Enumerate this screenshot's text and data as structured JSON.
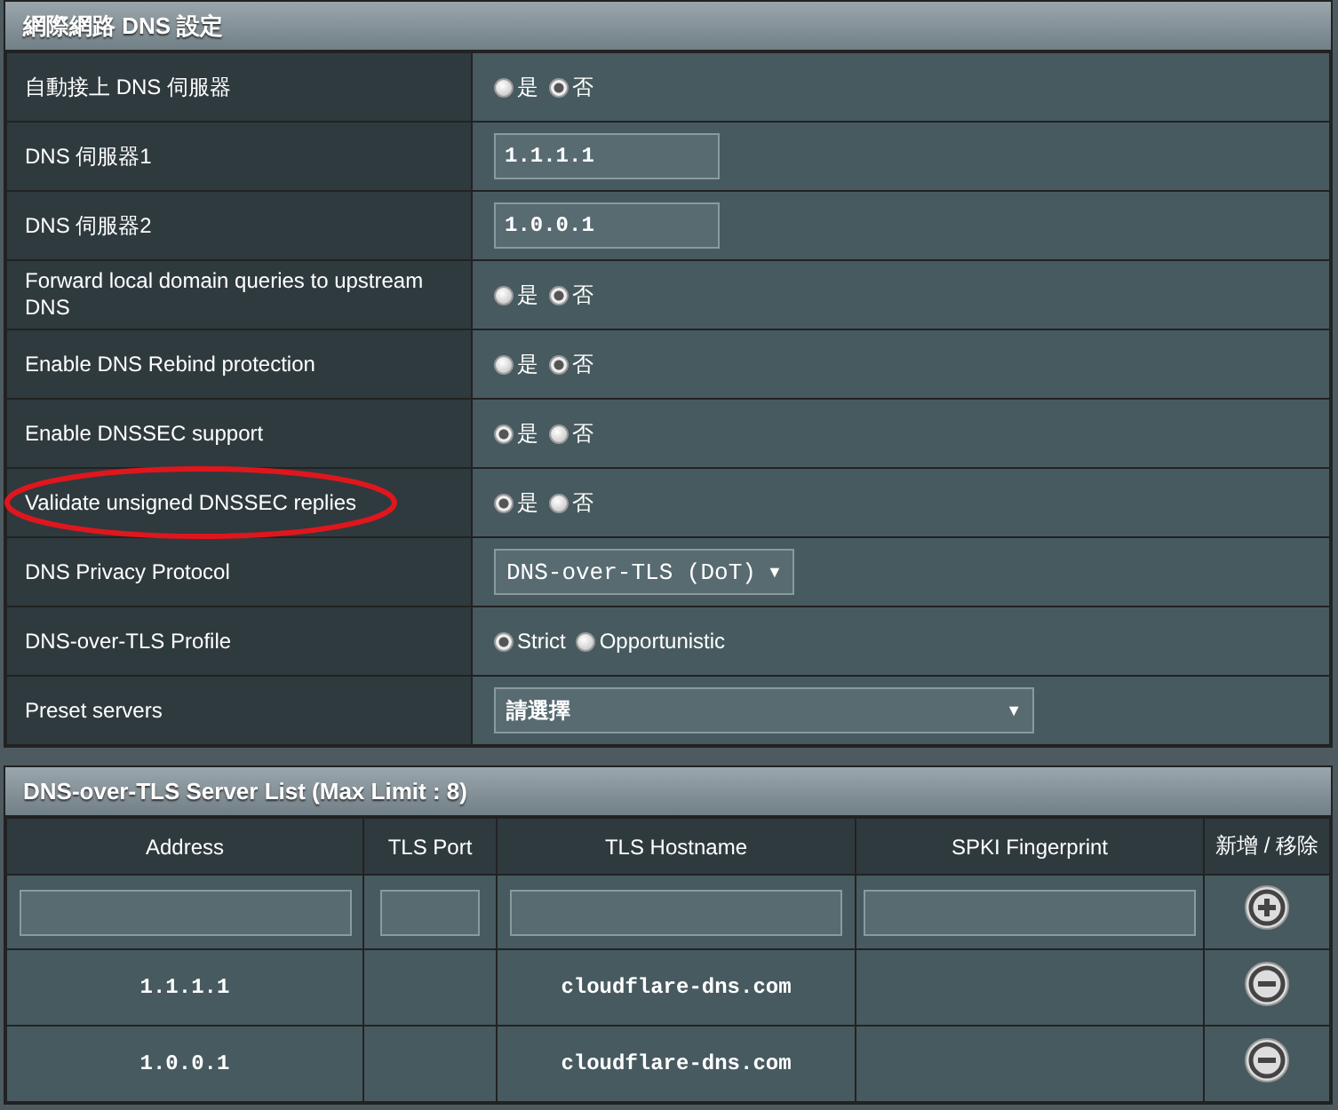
{
  "settings": {
    "title": "網際網路 DNS 設定",
    "rows": [
      {
        "label": "自動接上 DNS 伺服器",
        "kind": "radio",
        "highlighted": false,
        "options": [
          {
            "label": "是",
            "selected": false
          },
          {
            "label": "否",
            "selected": true
          }
        ]
      },
      {
        "label": "DNS 伺服器1",
        "kind": "input",
        "highlighted": false,
        "value": "1.1.1.1"
      },
      {
        "label": "DNS 伺服器2",
        "kind": "input",
        "highlighted": false,
        "value": "1.0.0.1"
      },
      {
        "label": "Forward local domain queries to upstream DNS",
        "kind": "radio",
        "highlighted": false,
        "options": [
          {
            "label": "是",
            "selected": false
          },
          {
            "label": "否",
            "selected": true
          }
        ]
      },
      {
        "label": "Enable DNS Rebind protection",
        "kind": "radio",
        "highlighted": false,
        "options": [
          {
            "label": "是",
            "selected": false
          },
          {
            "label": "否",
            "selected": true
          }
        ]
      },
      {
        "label": "Enable DNSSEC support",
        "kind": "radio",
        "highlighted": false,
        "options": [
          {
            "label": "是",
            "selected": true
          },
          {
            "label": "否",
            "selected": false
          }
        ]
      },
      {
        "label": "Validate unsigned DNSSEC replies",
        "kind": "radio",
        "highlighted": true,
        "options": [
          {
            "label": "是",
            "selected": true
          },
          {
            "label": "否",
            "selected": false
          }
        ]
      },
      {
        "label": "DNS Privacy Protocol",
        "kind": "select",
        "highlighted": false,
        "value": "DNS-over-TLS (DoT)",
        "arrow": "▼"
      },
      {
        "label": "DNS-over-TLS Profile",
        "kind": "radio",
        "highlighted": false,
        "options": [
          {
            "label": "Strict",
            "selected": true
          },
          {
            "label": "Opportunistic",
            "selected": false
          }
        ]
      },
      {
        "label": "Preset servers",
        "kind": "wideselect",
        "highlighted": false,
        "value": "請選擇",
        "arrow": "▼"
      }
    ]
  },
  "server_list": {
    "title": "DNS-over-TLS Server List (Max Limit : 8)",
    "columns": [
      "Address",
      "TLS Port",
      "TLS Hostname",
      "SPKI Fingerprint",
      "新增 / 移除"
    ],
    "rows": [
      {
        "address": "1.1.1.1",
        "tls_port": "",
        "hostname": "cloudflare-dns.com",
        "spki": ""
      },
      {
        "address": "1.0.0.1",
        "tls_port": "",
        "hostname": "cloudflare-dns.com",
        "spki": ""
      }
    ]
  }
}
